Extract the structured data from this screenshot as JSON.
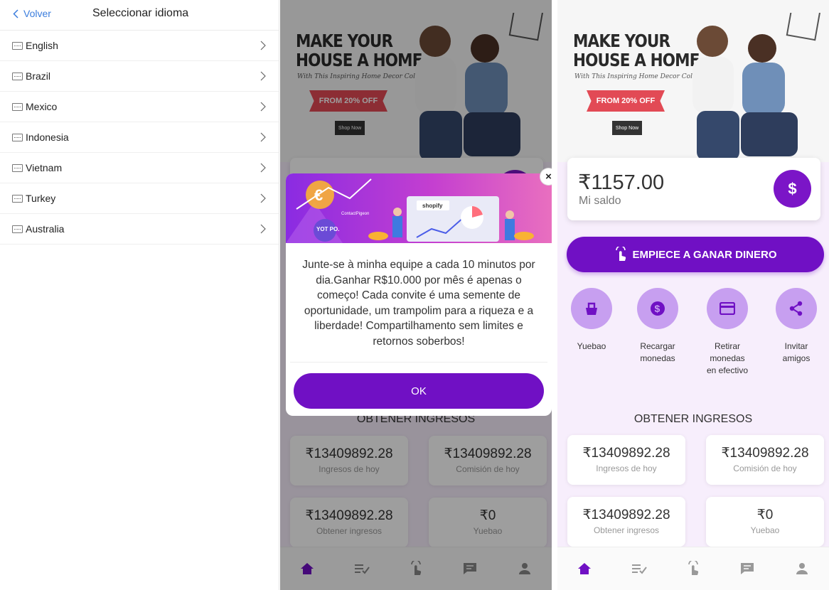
{
  "language_screen": {
    "back_label": "Volver",
    "title": "Seleccionar idioma",
    "languages": [
      {
        "label": "English"
      },
      {
        "label": "Brazil"
      },
      {
        "label": "Mexico"
      },
      {
        "label": "Indonesia"
      },
      {
        "label": "Vietnam"
      },
      {
        "label": "Turkey"
      },
      {
        "label": "Australia"
      }
    ]
  },
  "banner": {
    "headline_line1": "MAKE YOUR",
    "headline_line2": "HOUSE A HOME",
    "subline": "With This Inspiring Home Decor Collection",
    "promo": "FROM 20% OFF",
    "shop_button": "Shop Now"
  },
  "balance": {
    "amount": "₹1157.00",
    "label": "Mi saldo",
    "icon": "dollar-icon"
  },
  "earn_button_label": "EMPIECE A GANAR DINERO",
  "quick_actions": [
    {
      "label_line1": "Yuebao",
      "label_line2": "",
      "label_line3": "",
      "icon": "yuebao-icon"
    },
    {
      "label_line1": "Recargar",
      "label_line2": "monedas",
      "label_line3": "",
      "icon": "coin-icon"
    },
    {
      "label_line1": "Retirar",
      "label_line2": "monedas",
      "label_line3": "en efectivo",
      "icon": "card-icon"
    },
    {
      "label_line1": "Invitar",
      "label_line2": "amigos",
      "label_line3": "",
      "icon": "share-icon"
    }
  ],
  "income_section_title": "OBTENER INGRESOS",
  "stats": [
    {
      "value": "₹13409892.28",
      "label": "Ingresos de hoy"
    },
    {
      "value": "₹13409892.28",
      "label": "Comisión de hoy"
    },
    {
      "value": "₹13409892.28",
      "label": "Obtener ingresos"
    },
    {
      "value": "₹0",
      "label": "Yuebao"
    }
  ],
  "tabbar": [
    "home-icon",
    "tasks-icon",
    "earn-icon",
    "chat-icon",
    "profile-icon"
  ],
  "modal": {
    "art_labels": {
      "shopify": "shopify",
      "euro": "€",
      "contact": "ContactPigeon",
      "yotpo": "YOT PO."
    },
    "message": "Junte-se à minha equipe a cada 10 minutos por dia.Ganhar R$10.000 por mês é apenas o começo!  Cada convite é uma semente de oportunidade, um trampolim para a riqueza e a liberdade! Compartilhamento sem limites e retornos soberbos!",
    "ok_label": "OK",
    "close_label": "×"
  },
  "colors": {
    "brand_purple": "#7010c4",
    "light_purple": "#c79ff0",
    "link_blue": "#3b7ddd",
    "promo_red": "#e24a55"
  }
}
